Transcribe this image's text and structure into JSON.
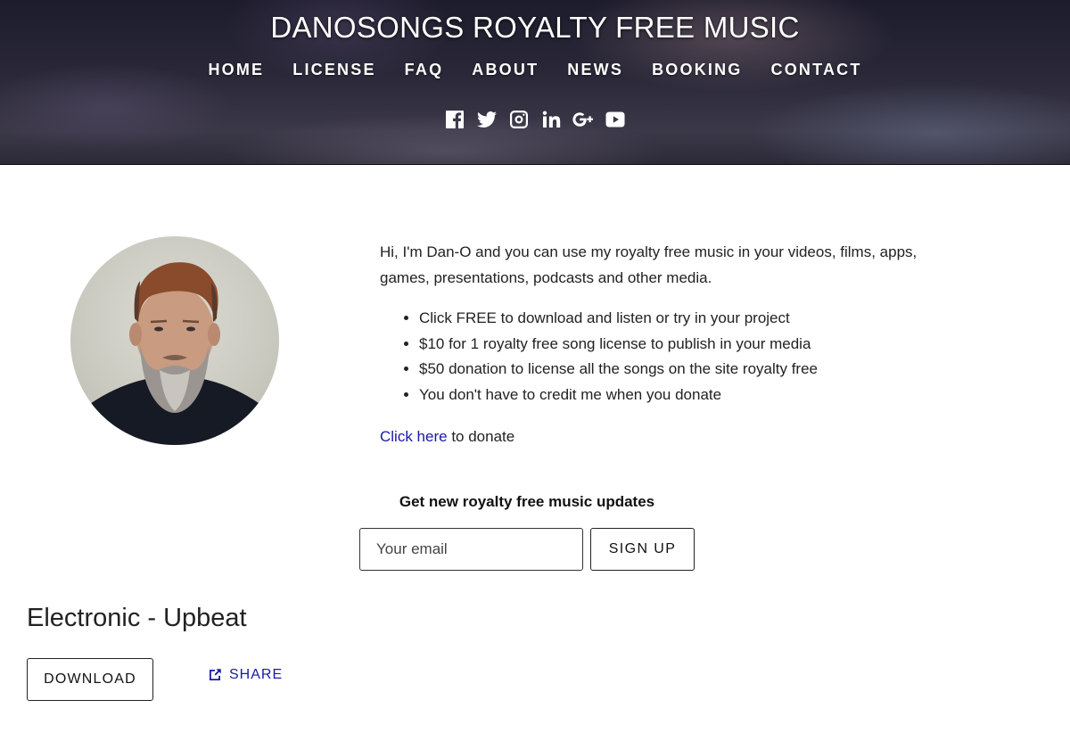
{
  "header": {
    "site_title": "DANOSONGS ROYALTY FREE MUSIC",
    "nav": [
      {
        "label": "HOME"
      },
      {
        "label": "LICENSE"
      },
      {
        "label": "FAQ"
      },
      {
        "label": "ABOUT"
      },
      {
        "label": "NEWS"
      },
      {
        "label": "BOOKING"
      },
      {
        "label": "CONTACT"
      }
    ],
    "social_icons": [
      "facebook-icon",
      "twitter-icon",
      "instagram-icon",
      "linkedin-icon",
      "google-plus-icon",
      "youtube-icon"
    ]
  },
  "intro": {
    "paragraph": "Hi, I'm Dan-O and you can use my royalty free music in your videos, films, apps, games, presentations, podcasts and other media.",
    "bullets": [
      "Click FREE to download and listen or try in your project",
      "$10 for 1 royalty free song license to publish in your media",
      "$50 donation to license all the songs on the site royalty free",
      "You don't have to credit me when you donate"
    ],
    "donate_link": "Click here",
    "donate_suffix": " to donate"
  },
  "signup": {
    "heading": "Get new royalty free music updates",
    "email_placeholder": "Your email",
    "button_label": "SIGN UP"
  },
  "song": {
    "title": "Electronic - Upbeat",
    "download_label": "DOWNLOAD",
    "share_label": "SHARE"
  },
  "colors": {
    "link": "#1a1aa6",
    "header_text": "#ffffff",
    "body_text": "#222222"
  }
}
